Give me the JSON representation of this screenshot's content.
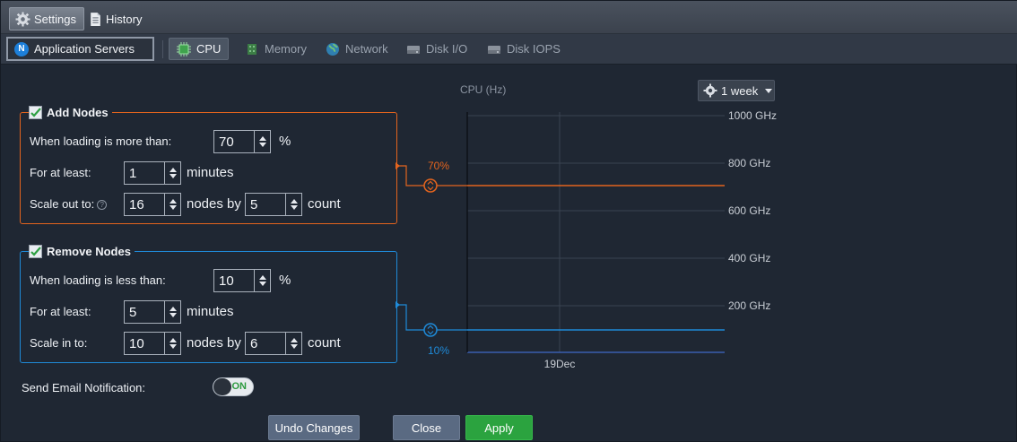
{
  "top_tabs": [
    {
      "label": "Settings",
      "icon": "gear-icon",
      "active": true
    },
    {
      "label": "History",
      "icon": "document-icon",
      "active": false
    }
  ],
  "app_selector": {
    "label": "Application Servers",
    "badge": "N"
  },
  "sub_tabs": [
    {
      "label": "CPU",
      "icon": "cpu-icon",
      "active": true
    },
    {
      "label": "Memory",
      "icon": "memory-icon",
      "active": false
    },
    {
      "label": "Network",
      "icon": "globe-icon",
      "active": false
    },
    {
      "label": "Disk I/O",
      "icon": "disk-icon",
      "active": false
    },
    {
      "label": "Disk IOPS",
      "icon": "disk-icon",
      "active": false
    }
  ],
  "add_nodes": {
    "title": "Add Nodes",
    "checked": true,
    "color": "#e3641e",
    "threshold_label": "When loading is more than:",
    "threshold_value": "70",
    "threshold_unit": "%",
    "duration_label": "For at least:",
    "duration_value": "1",
    "duration_unit": "minutes",
    "scale_label": "Scale out to:",
    "scale_nodes": "16",
    "nodes_by": "nodes by",
    "scale_count": "5",
    "count_unit": "count"
  },
  "remove_nodes": {
    "title": "Remove Nodes",
    "checked": true,
    "color": "#1f8ad8",
    "threshold_label": "When loading is less than:",
    "threshold_value": "10",
    "threshold_unit": "%",
    "duration_label": "For at least:",
    "duration_value": "5",
    "duration_unit": "minutes",
    "scale_label": "Scale in to:",
    "scale_nodes": "10",
    "nodes_by": "nodes by",
    "scale_count": "6",
    "count_unit": "count"
  },
  "chart": {
    "title": "CPU (Hz)",
    "period": "1 week",
    "y_ticks": [
      {
        "label": "1000 GHz",
        "value": 1000
      },
      {
        "label": "800 GHz",
        "value": 800
      },
      {
        "label": "600 GHz",
        "value": 600
      },
      {
        "label": "400 GHz",
        "value": 400
      },
      {
        "label": "200 GHz",
        "value": 200
      }
    ],
    "x_label": "19Dec",
    "upper_threshold": {
      "label": "70%",
      "value": 70
    },
    "lower_threshold": {
      "label": "10%",
      "value": 10
    }
  },
  "email": {
    "label": "Send Email Notification:",
    "toggle": "ON"
  },
  "buttons": {
    "undo": "Undo Changes",
    "close": "Close",
    "apply": "Apply"
  }
}
